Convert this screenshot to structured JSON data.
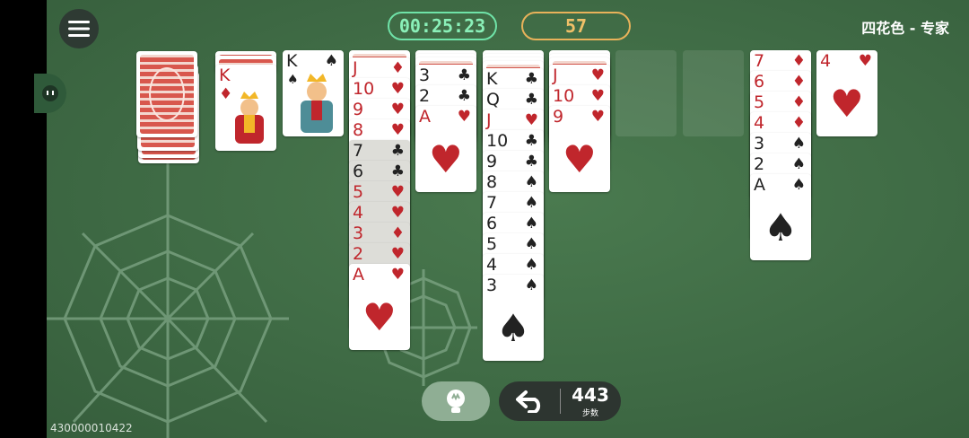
{
  "header": {
    "timer": "00:25:23",
    "score": "57",
    "mode": "四花色 - 专家"
  },
  "stock": {
    "label": "stock-pile"
  },
  "foundations": [
    {
      "rank": "K",
      "suit": "♦",
      "color": "red"
    },
    {
      "rank": "K",
      "suit": "♠",
      "color": "blk"
    }
  ],
  "columns": [
    {
      "cards": [
        [
          "J",
          "♦",
          "red"
        ],
        [
          "10",
          "♥",
          "red"
        ],
        [
          "9",
          "♥",
          "red"
        ],
        [
          "8",
          "♥",
          "red"
        ],
        [
          "7",
          "♣",
          "blk"
        ],
        [
          "6",
          "♣",
          "blk"
        ],
        [
          "5",
          "♥",
          "red"
        ],
        [
          "4",
          "♥",
          "red"
        ],
        [
          "3",
          "♦",
          "red"
        ],
        [
          "2",
          "♥",
          "red"
        ],
        [
          "A",
          "♥",
          "red"
        ]
      ]
    },
    {
      "cards": [
        [
          "3",
          "♣",
          "blk"
        ],
        [
          "2",
          "♣",
          "blk"
        ],
        [
          "A",
          "♥",
          "red"
        ]
      ]
    },
    {
      "cards": [
        [
          "K",
          "♣",
          "blk"
        ],
        [
          "Q",
          "♣",
          "blk"
        ],
        [
          "J",
          "♥",
          "red"
        ],
        [
          "10",
          "♣",
          "blk"
        ],
        [
          "9",
          "♣",
          "blk"
        ],
        [
          "8",
          "♠",
          "blk"
        ],
        [
          "7",
          "♠",
          "blk"
        ],
        [
          "6",
          "♠",
          "blk"
        ],
        [
          "5",
          "♠",
          "blk"
        ],
        [
          "4",
          "♠",
          "blk"
        ],
        [
          "3",
          "♠",
          "blk"
        ]
      ]
    },
    {
      "cards": [
        [
          "J",
          "♥",
          "red"
        ],
        [
          "10",
          "♥",
          "red"
        ],
        [
          "9",
          "♥",
          "red"
        ]
      ]
    },
    {
      "cards": []
    },
    {
      "cards": []
    },
    {
      "cards": [
        [
          "7",
          "♦",
          "red"
        ],
        [
          "6",
          "♦",
          "red"
        ],
        [
          "5",
          "♦",
          "red"
        ],
        [
          "4",
          "♦",
          "red"
        ],
        [
          "3",
          "♠",
          "blk"
        ],
        [
          "2",
          "♠",
          "blk"
        ],
        [
          "A",
          "♠",
          "blk"
        ]
      ]
    },
    {
      "cards": [
        [
          "4",
          "♥",
          "red"
        ]
      ]
    }
  ],
  "controls": {
    "moves_count": "443",
    "moves_label": "步数"
  },
  "footer": {
    "game_id": "430000010422"
  }
}
